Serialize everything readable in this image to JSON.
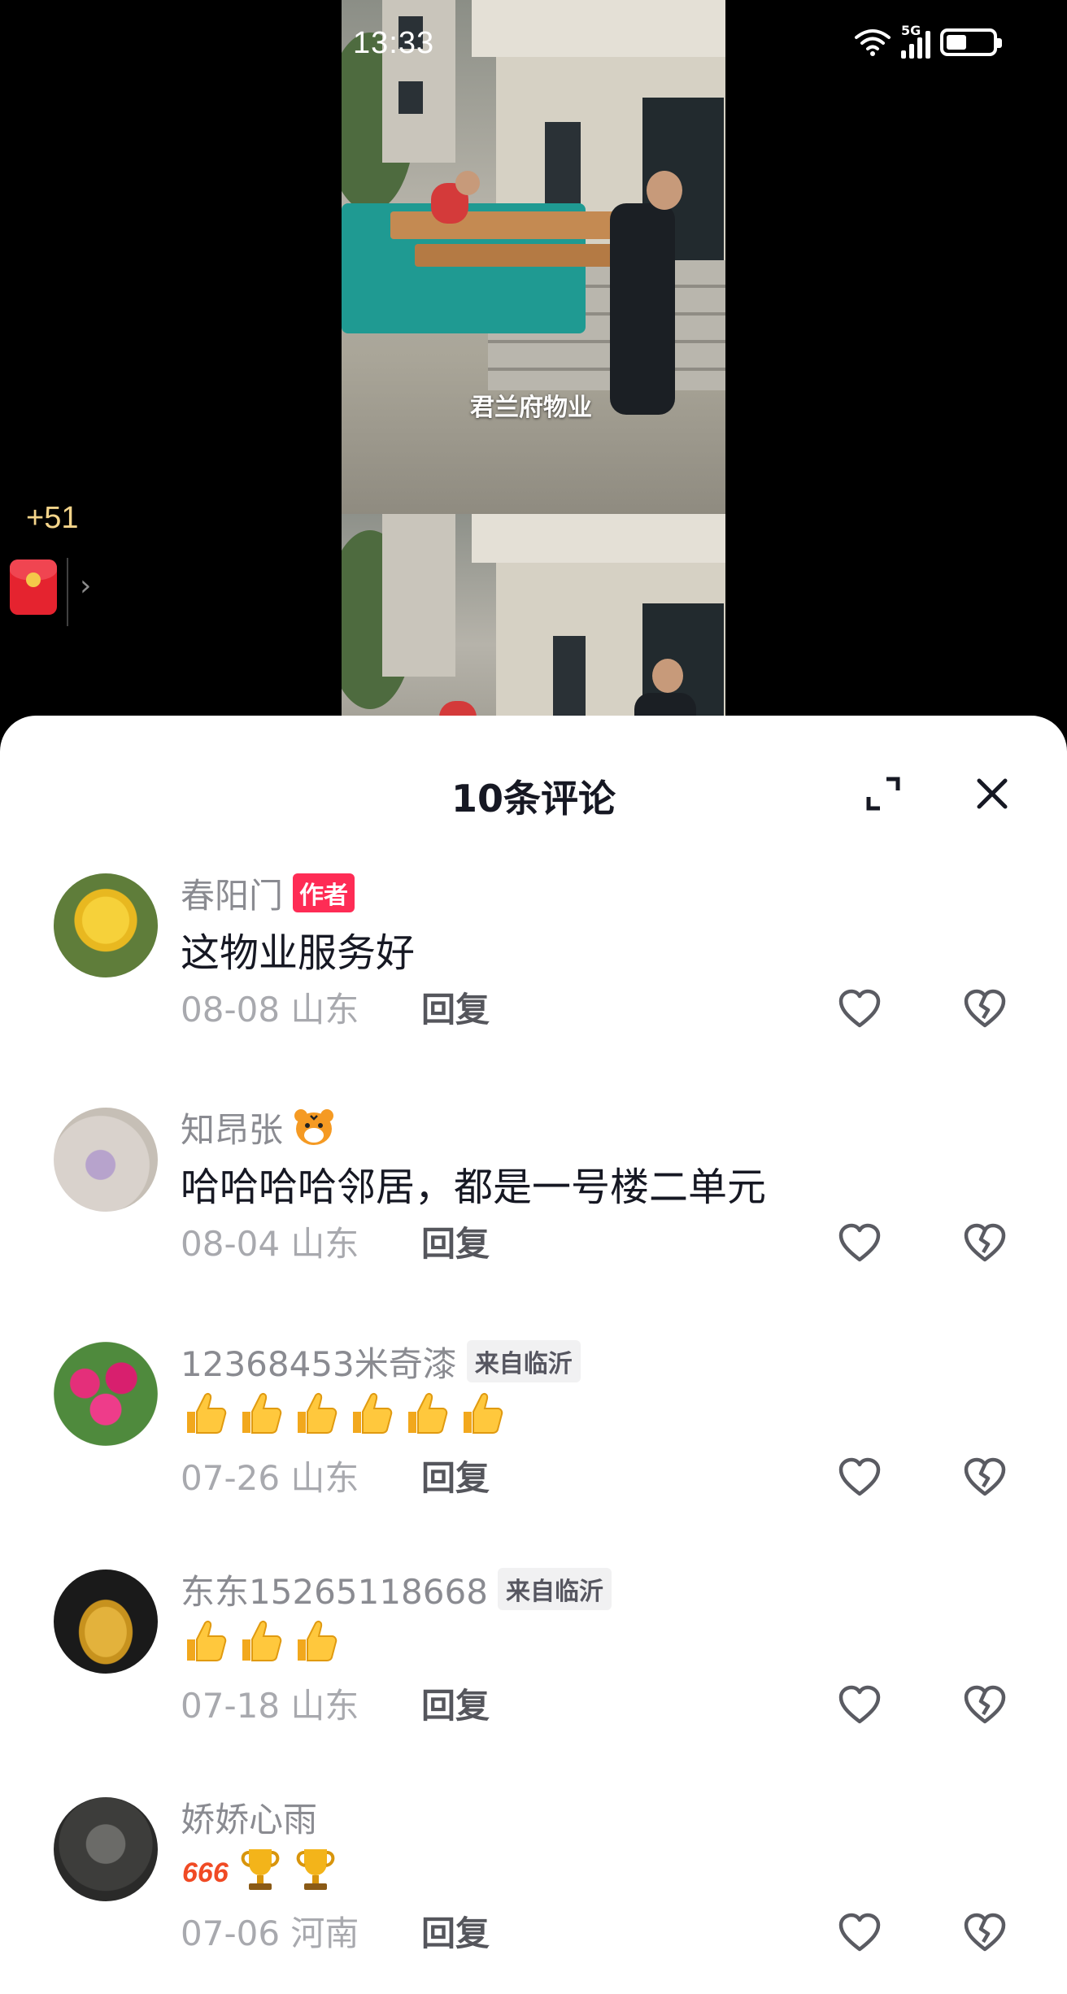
{
  "status_bar": {
    "time": "13:33",
    "network_type": "5G",
    "battery_percent": 45
  },
  "video": {
    "watermark": "君兰府物业"
  },
  "red_packet": {
    "count_label": "+51",
    "chevron": "›"
  },
  "comments_sheet": {
    "title": "10条评论",
    "comments": [
      {
        "username": "春阳门",
        "tag": "作者",
        "tag_type": "author",
        "text": "这物业服务好",
        "meta": "08-08 山东",
        "reply_label": "回复",
        "avatar": "yellow-rose"
      },
      {
        "username": "知昂张",
        "name_emoji": "tiger-emoji",
        "text": "哈哈哈哈邻居，都是一号楼二单元",
        "meta": "08-04 山东",
        "reply_label": "回复",
        "avatar": "purple-flower"
      },
      {
        "username": "12368453米奇漆",
        "tag": "来自临沂",
        "tag_type": "location",
        "text_emojis": [
          "thumbs-up",
          "thumbs-up",
          "thumbs-up",
          "thumbs-up",
          "thumbs-up",
          "thumbs-up"
        ],
        "meta": "07-26 山东",
        "reply_label": "回复",
        "avatar": "pink-bouquet"
      },
      {
        "username": "东东15265118668",
        "tag": "来自临沂",
        "tag_type": "location",
        "text_emojis": [
          "thumbs-up",
          "thumbs-up",
          "thumbs-up"
        ],
        "meta": "07-18 山东",
        "reply_label": "回复",
        "avatar": "gold-figure"
      },
      {
        "username": "娇娇心雨",
        "text_emojis": [
          "666",
          "trophy",
          "trophy"
        ],
        "meta": "07-06 河南",
        "reply_label": "回复",
        "avatar": "dark-photo"
      }
    ]
  },
  "colors": {
    "author_tag": "#fe2c55",
    "packet_red": "#e5232f",
    "packet_count": "#f4d48a"
  }
}
